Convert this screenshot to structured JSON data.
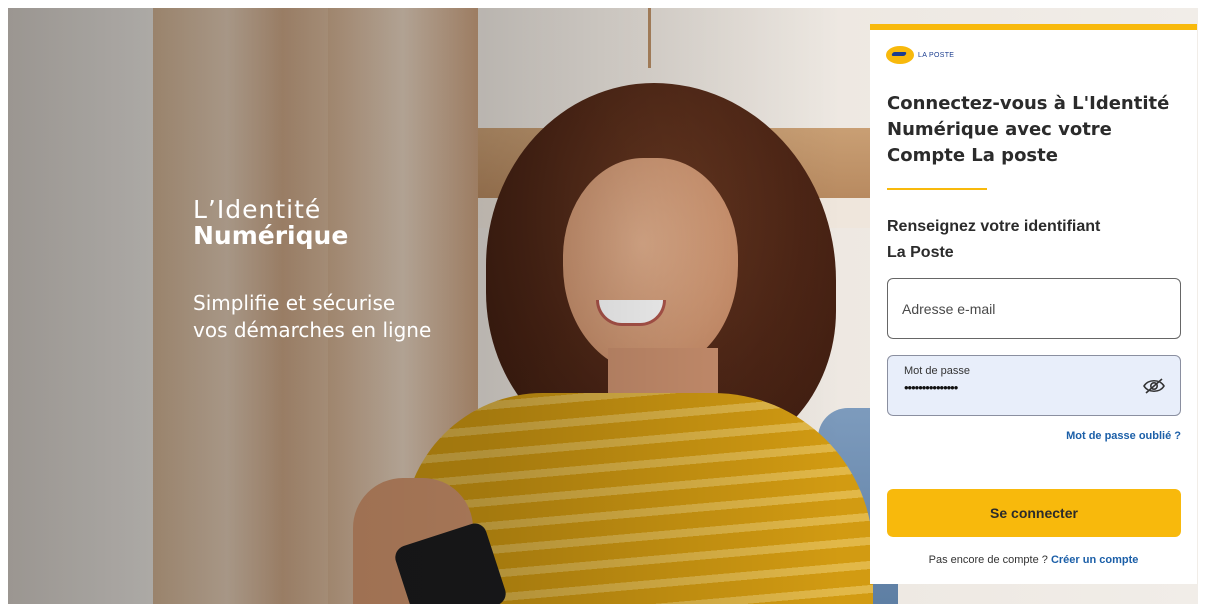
{
  "hero": {
    "brand_line1": "L’Identité",
    "brand_line2": "Numérique",
    "tagline_line1": "Simplifie et sécurise",
    "tagline_line2": "vos démarches en ligne"
  },
  "card": {
    "logo_text": "LA POSTE",
    "title": "Connectez-vous à L'Identité Numérique avec votre Compte La poste",
    "subtitle_line1": "Renseignez votre identifiant",
    "subtitle_line2": "La Poste",
    "email_placeholder": "Adresse e-mail",
    "password_label": "Mot de passe",
    "password_value": "•••••••••••••••",
    "forgot_link": "Mot de passe oublié ?",
    "submit_label": "Se connecter",
    "signup_prompt": "Pas encore de compte ?",
    "signup_link": "Créer un compte"
  },
  "colors": {
    "accent": "#f8b90c",
    "link": "#1b5fa8",
    "password_field_bg": "#e8eefa"
  }
}
